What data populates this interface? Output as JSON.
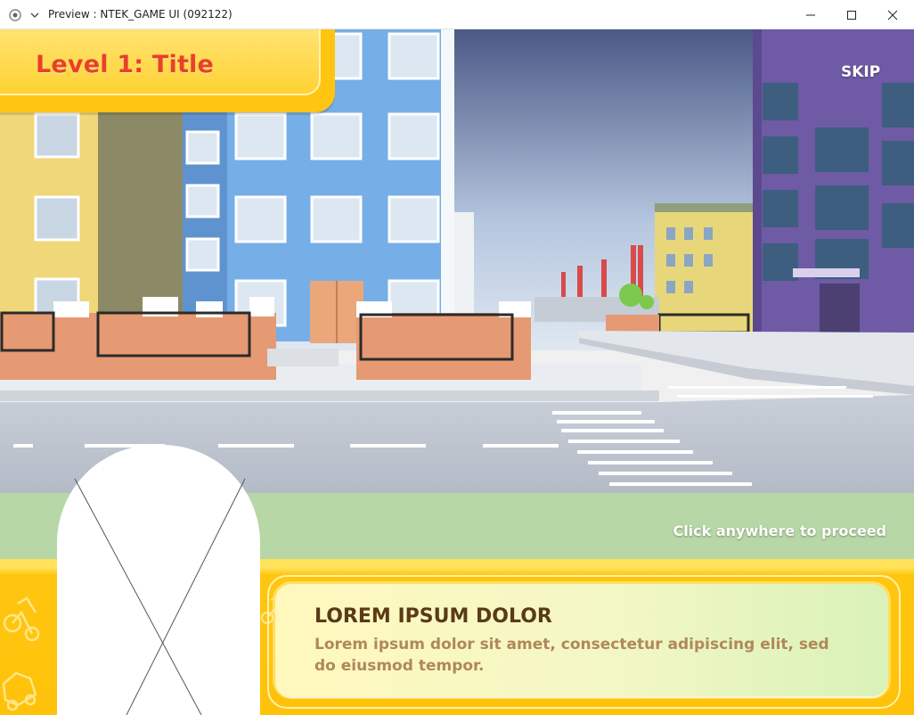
{
  "window": {
    "title": "Preview : NTEK_GAME UI (092122)",
    "app_icon": "record-icon",
    "menu_icon": "chevron-down-icon",
    "controls": [
      "minimize-icon",
      "maximize-icon",
      "close-icon"
    ]
  },
  "hud": {
    "level_title": "Level 1: Title",
    "skip_label": "SKIP",
    "proceed_hint": "Click anywhere to proceed"
  },
  "dialog": {
    "heading": "LOREM IPSUM DOLOR",
    "body": "Lorem ipsum dolor sit amet, consectetur adipiscing elit, sed do eiusmod tempor.",
    "portrait": "character-portrait-placeholder"
  },
  "colors": {
    "accent_yellow": "#ffc512",
    "title_red": "#e8402b",
    "heading_brown": "#5a3a17",
    "body_tan": "#b0885a"
  },
  "decor_icons": [
    "bicycle-icon",
    "car-icon",
    "bicycle-icon"
  ]
}
